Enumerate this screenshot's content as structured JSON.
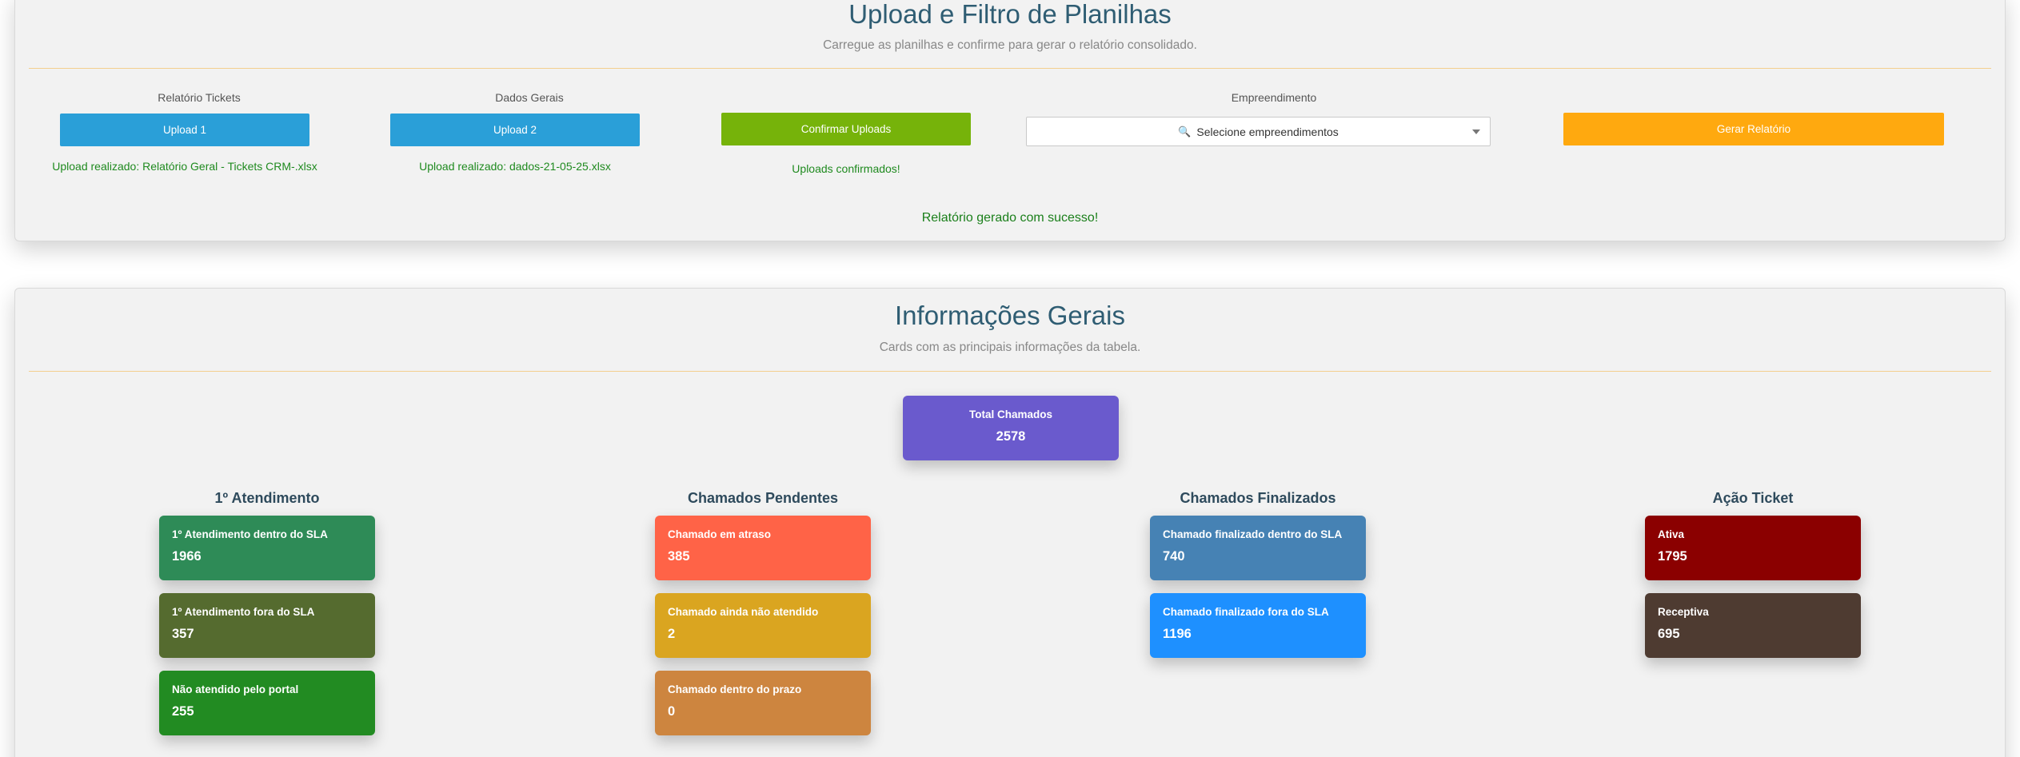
{
  "upload_section": {
    "title": "Upload e Filtro de Planilhas",
    "subtitle": "Carregue as planilhas e confirme para gerar o relatório consolidado.",
    "col1": {
      "label": "Relatório Tickets",
      "button": "Upload 1",
      "status": "Upload realizado: Relatório Geral - Tickets CRM-.xlsx"
    },
    "col2": {
      "label": "Dados Gerais",
      "button": "Upload 2",
      "status": "Upload realizado: dados-21-05-25.xlsx"
    },
    "col3": {
      "button": "Confirmar Uploads",
      "status": "Uploads confirmados!"
    },
    "col4": {
      "label": "Empreendimento",
      "select_value": "Selecione empreendimentos",
      "select_icon": "magnifier-icon"
    },
    "col5": {
      "button": "Gerar Relatório"
    },
    "success": "Relatório gerado com sucesso!"
  },
  "info_section": {
    "title": "Informações Gerais",
    "subtitle": "Cards com as principais informações da tabela.",
    "total": {
      "label": "Total Chamados",
      "value": "2578",
      "color": "#6a5acd"
    },
    "groups": [
      {
        "title": "1º Atendimento",
        "cards": [
          {
            "label": "1º Atendimento dentro do SLA",
            "value": "1966",
            "color": "#2e8b57"
          },
          {
            "label": "1º Atendimento fora do SLA",
            "value": "357",
            "color": "#556b2f"
          },
          {
            "label": "Não atendido pelo portal",
            "value": "255",
            "color": "#228b22"
          }
        ]
      },
      {
        "title": "Chamados Pendentes",
        "cards": [
          {
            "label": "Chamado em atraso",
            "value": "385",
            "color": "#ff6347"
          },
          {
            "label": "Chamado ainda não atendido",
            "value": "2",
            "color": "#daa520"
          },
          {
            "label": "Chamado dentro do prazo",
            "value": "0",
            "color": "#cd853f"
          }
        ]
      },
      {
        "title": "Chamados Finalizados",
        "cards": [
          {
            "label": "Chamado finalizado dentro do SLA",
            "value": "740",
            "color": "#4682b4"
          },
          {
            "label": "Chamado finalizado fora do SLA",
            "value": "1196",
            "color": "#1e90ff"
          }
        ]
      },
      {
        "title": "Ação Ticket",
        "cards": [
          {
            "label": "Ativa",
            "value": "1795",
            "color": "#8b0000"
          },
          {
            "label": "Receptiva",
            "value": "695",
            "color": "#4e3b31"
          }
        ]
      }
    ]
  }
}
